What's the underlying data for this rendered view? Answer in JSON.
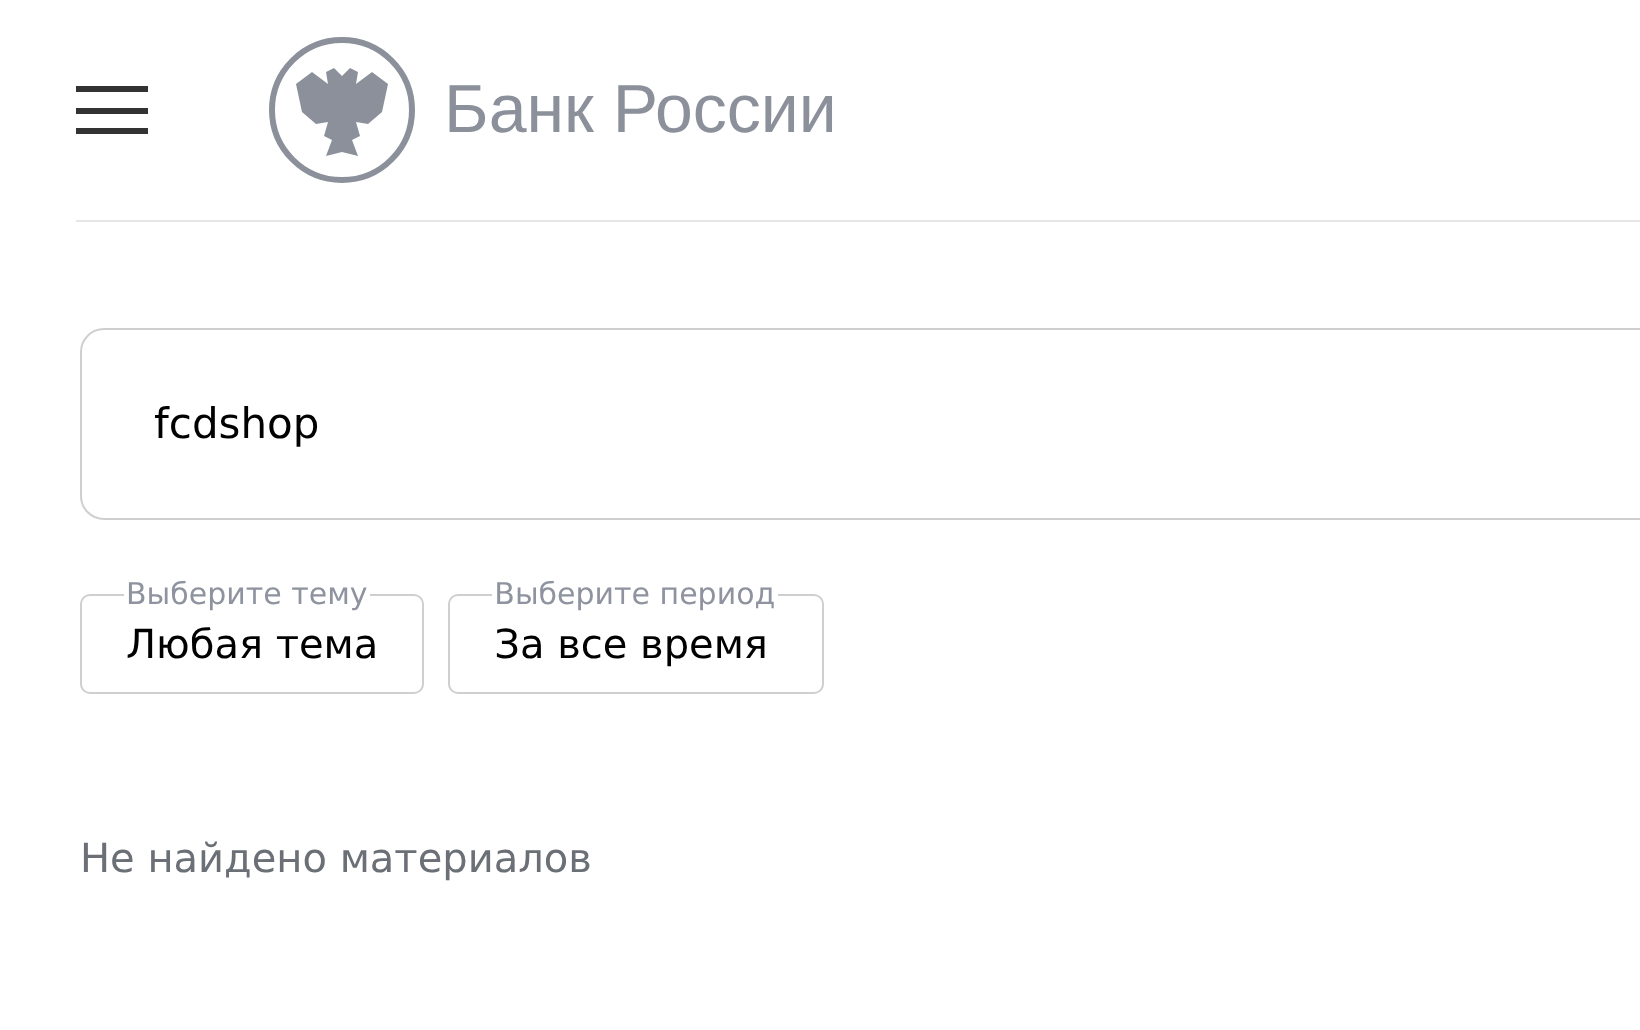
{
  "header": {
    "logo_text": "Банк России"
  },
  "search": {
    "value": "fcdshop"
  },
  "filters": [
    {
      "legend": "Выберите тему",
      "value": "Любая тема"
    },
    {
      "legend": "Выберите период",
      "value": "За все время"
    }
  ],
  "result_message": "Не найдено материалов"
}
